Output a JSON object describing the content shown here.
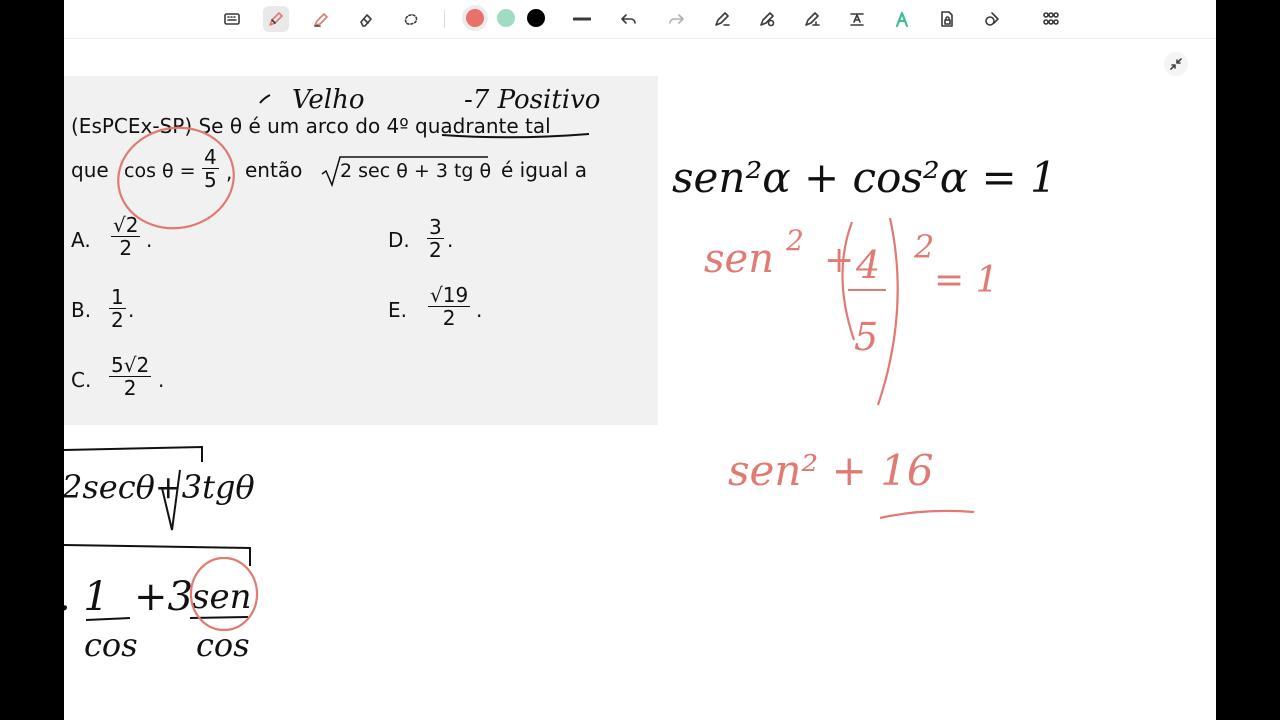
{
  "toolbar": {
    "tools": [
      {
        "icon": "keyboard-icon"
      },
      {
        "icon": "pen-icon",
        "active": true
      },
      {
        "icon": "highlighter-icon"
      },
      {
        "icon": "eraser-icon"
      },
      {
        "icon": "lasso-icon"
      }
    ],
    "colors": [
      "#e8716c",
      "#9fdcc4",
      "#000000"
    ],
    "selected_color": "#e8716c",
    "actions": [
      {
        "icon": "stroke-width-icon"
      },
      {
        "icon": "undo-icon"
      },
      {
        "icon": "redo-icon"
      },
      {
        "icon": "shape-pen-icon"
      },
      {
        "icon": "pen-settings-icon"
      },
      {
        "icon": "text-pen-icon"
      },
      {
        "icon": "text-recognition-icon"
      },
      {
        "icon": "ai-assist-icon"
      },
      {
        "icon": "lock-page-icon"
      },
      {
        "icon": "shapes-icon"
      },
      {
        "icon": "grid-menu-icon"
      }
    ]
  },
  "question": {
    "line1": "(EsPCEx-SP) Se θ é um arco do 4º quadrante tal",
    "line2_prefix": "que",
    "cos_label": "cos θ =",
    "cos_num": "4",
    "cos_den": "5",
    "comma": ",",
    "line2_mid": "então",
    "radicand": "2 sec θ + 3 tg θ",
    "line2_suffix": "é igual a",
    "options": [
      {
        "label": "A.",
        "num": "√2",
        "den": "2",
        "end": "."
      },
      {
        "label": "B.",
        "num": "1",
        "den": "2",
        "end": "."
      },
      {
        "label": "C.",
        "num": "5√2",
        "den": "2",
        "end": "."
      },
      {
        "label": "D.",
        "num": "3",
        "den": "2",
        "end": "."
      },
      {
        "label": "E.",
        "num": "√19",
        "den": "2",
        "end": "."
      }
    ]
  },
  "annotations": {
    "note_velho": "Velho",
    "note_positivo": "-7 Positivo",
    "identity": "sen²α + cos²α = 1",
    "sub_sen": "sen",
    "sub_exp": "2",
    "sub_num": "4",
    "sub_den": "5",
    "sub_eq": "= 1",
    "line3": "sen² + 16",
    "work1": "2secθ+3tgθ",
    "work2_a": ". 1",
    "work2_b": "+3",
    "work2_sen": "sen",
    "work2_cos1": "cos",
    "work2_cos2": "cos"
  },
  "colors": {
    "ink_red": "#e07a72",
    "ink_black": "#111111",
    "panel_bg": "#f1f1f1"
  }
}
